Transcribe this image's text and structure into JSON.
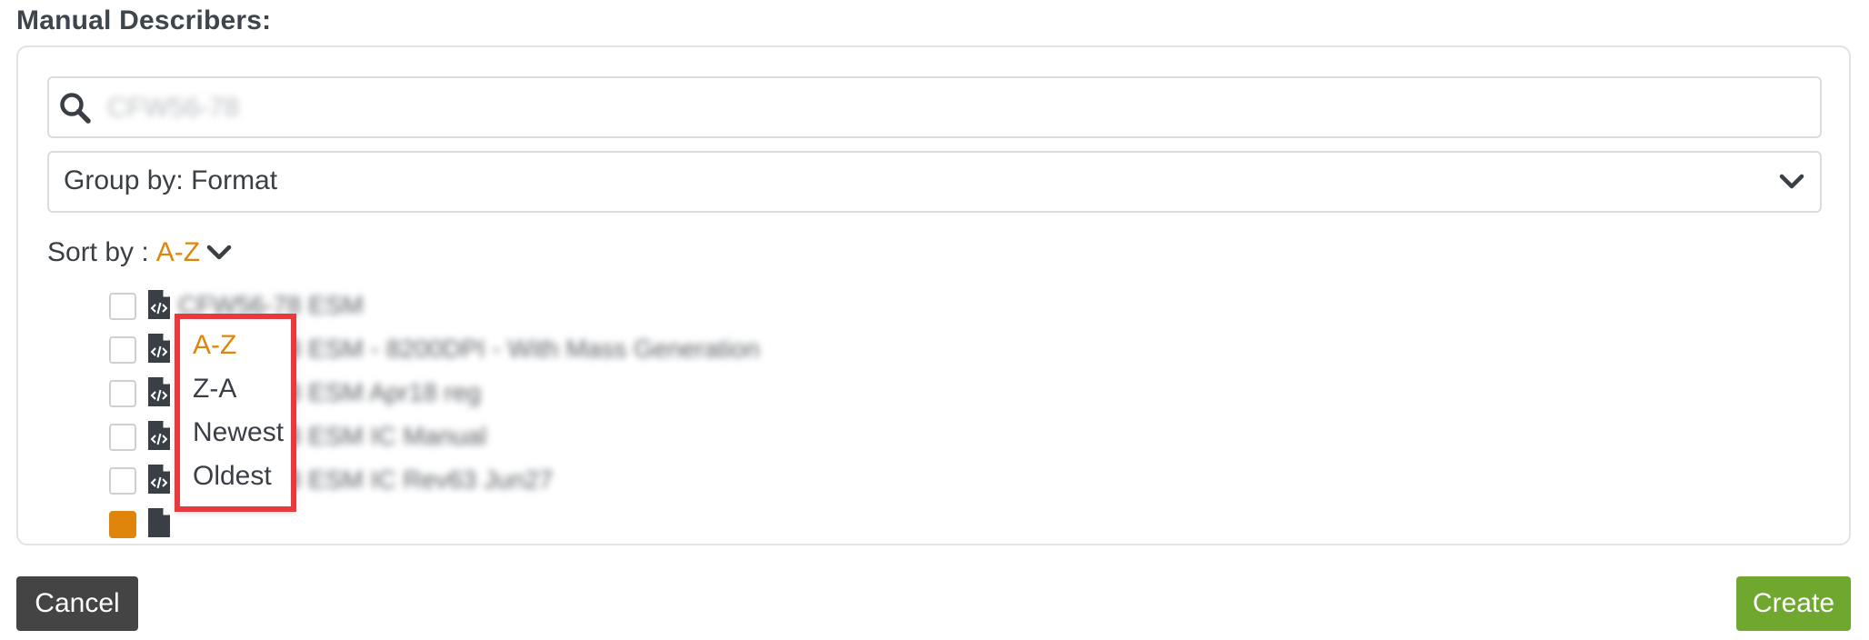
{
  "section": {
    "title": "Manual Describers:"
  },
  "search": {
    "value": "CFW56-78",
    "icon": "search-icon"
  },
  "group_by": {
    "label": "Group by: Format",
    "icon": "chevron-down-icon"
  },
  "sort": {
    "label": "Sort by :",
    "value": "A-Z",
    "icon": "chevron-down-icon",
    "options": [
      {
        "label": "A-Z",
        "selected": true
      },
      {
        "label": "Z-A",
        "selected": false
      },
      {
        "label": "Newest",
        "selected": false
      },
      {
        "label": "Oldest",
        "selected": false
      }
    ]
  },
  "list": {
    "items": [
      {
        "label": "CFW56-78 ESM",
        "checked": false,
        "icon": "code-file-icon"
      },
      {
        "label": "CFW56-78 ESM - 8200DPI - With Mass Generation",
        "checked": false,
        "icon": "code-file-icon"
      },
      {
        "label": "CFW56-78 ESM Apr18 reg",
        "checked": false,
        "icon": "code-file-icon"
      },
      {
        "label": "CFW56-78 ESM IC Manual",
        "checked": false,
        "icon": "code-file-icon"
      },
      {
        "label": "CFW56-78 ESM IC Rev63 Jun27",
        "checked": false,
        "icon": "code-file-icon"
      },
      {
        "label": "",
        "checked": true,
        "icon": "code-file-icon"
      }
    ]
  },
  "buttons": {
    "cancel": "Cancel",
    "create": "Create"
  },
  "colors": {
    "accent": "#e0850b",
    "highlight_border": "#e8393f",
    "create_button": "#6fa72f",
    "cancel_button": "#444444"
  }
}
